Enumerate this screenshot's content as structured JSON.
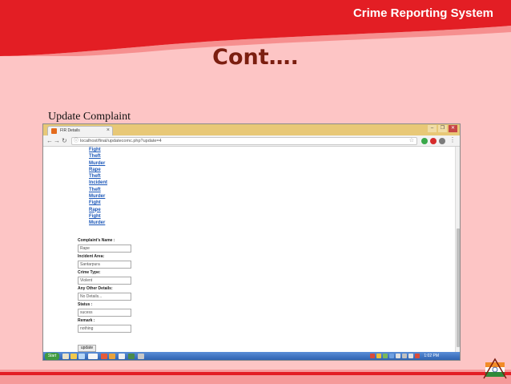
{
  "slide": {
    "header_title": "Crime Reporting System",
    "title": "Cont….",
    "subtitle": "Update Complaint",
    "logo_icon": "emblem-icon"
  },
  "browser": {
    "tab_title": "FIR Details",
    "tab_close": "×",
    "url": "localhost/final/updatecomc.php?update=4",
    "window_controls": [
      "–",
      "❐",
      "✕"
    ]
  },
  "type_links": [
    "Fight",
    "Theft",
    "Murder",
    "Rape",
    "Theft",
    "Incident",
    "Theft",
    "Murder",
    "Fight",
    "Rape",
    "Fight",
    "Murder"
  ],
  "form": {
    "name_label": "Complaint's Name :",
    "name_value": "Rape",
    "area_label": "Incident Area:",
    "area_value": "Santarpura",
    "type_label": "Crime Type:",
    "type_value": "Violent",
    "details_label": "Any Other Details:",
    "details_value": "No Details...",
    "status_label": "Status :",
    "status_value": "sucess",
    "remark_label": "Remark :",
    "remark_value": "nothing",
    "button_label": "update"
  },
  "taskbar": {
    "start_label": "Start",
    "clock": "1:02 PM"
  },
  "colors": {
    "slide_bg": "#fdc5c5",
    "header_red": "#e31e24",
    "title_color": "#7b1e10",
    "link_blue": "#1b57b8"
  }
}
